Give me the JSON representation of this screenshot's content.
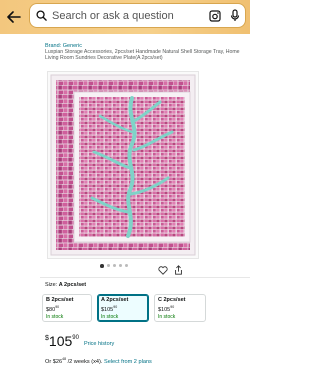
{
  "search": {
    "placeholder": "Search or ask a question",
    "back_icon": "back-arrow-icon",
    "lens_icon": "camera-lens-icon",
    "mic_icon": "microphone-icon"
  },
  "top_subline": "",
  "product": {
    "brand": "Brand: Generic",
    "title": "Luxpian Storage Accessories, 2pcs/set Handmade Natural Shell Storage Tray, Home Living Room Sundries Decorative Plate(A 2pcs/set)",
    "image_alt": "Pink mosaic shell tray with turquoise vine pattern"
  },
  "carousel": {
    "count": 5,
    "active_index": 0
  },
  "size": {
    "label": "Size:",
    "value": "A 2pcs/set"
  },
  "options": [
    {
      "name": "B 2pcs/set",
      "price": "$80",
      "price_cents": "90",
      "stock": "In stock",
      "selected": false
    },
    {
      "name": "A 2pcs/set",
      "price": "$105",
      "price_cents": "90",
      "stock": "In stock",
      "selected": true
    },
    {
      "name": "C 2pcs/set",
      "price": "$105",
      "price_cents": "90",
      "stock": "In stock",
      "selected": false
    }
  ],
  "price": {
    "symbol": "$",
    "whole": "105",
    "fraction": "90",
    "history_link": "Price history"
  },
  "offer": {
    "prefix": "Or ",
    "amount": "$26",
    "amount_cents": "48",
    "terms": " /2 weeks (x4). ",
    "link": "Select from 2 plans"
  },
  "colors": {
    "accent": "#007185",
    "instock": "#007600",
    "header": "#f3c77e",
    "tray_pink": "#c2508f",
    "tray_turquoise": "#7fd3c8"
  }
}
